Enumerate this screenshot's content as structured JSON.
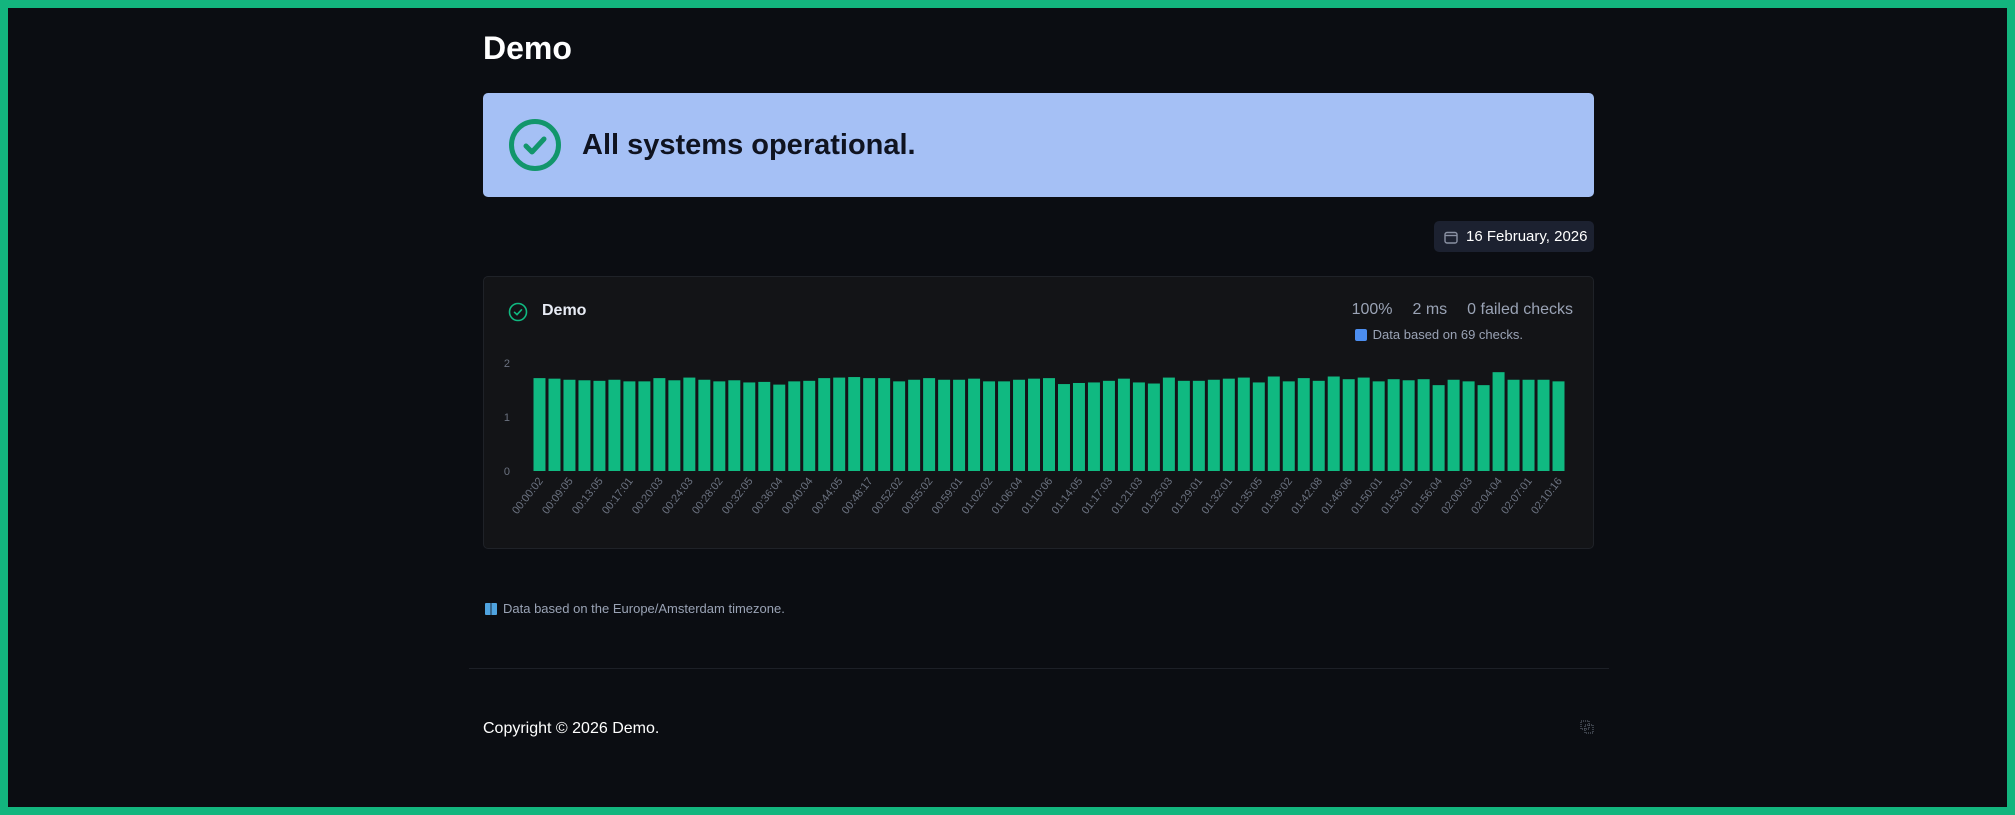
{
  "page": {
    "title": "Demo"
  },
  "banner": {
    "message": "All systems operational.",
    "icon": "check-circle-icon",
    "bg_color": "#a5c0f5",
    "icon_color": "#12966b"
  },
  "date_picker": {
    "value": "16 February, 2026",
    "icon": "calendar-icon"
  },
  "monitor": {
    "name": "Demo",
    "status_icon": "check-circle-icon",
    "uptime": "100%",
    "response_time": "2 ms",
    "failed_checks": "0 failed checks",
    "data_note": "Data based on 69 checks."
  },
  "chart_data": {
    "type": "bar",
    "color": "#10b981",
    "ylim": [
      0,
      2
    ],
    "yticks": [
      "0",
      "1",
      "2"
    ],
    "xlabel": "",
    "ylabel": "",
    "tick_labels": [
      "00:00:02",
      "00:09:05",
      "00:13:05",
      "00:17:01",
      "00:20:03",
      "00:24:03",
      "00:28:02",
      "00:32:05",
      "00:36:04",
      "00:40:04",
      "00:44:05",
      "00:48:17",
      "00:52:02",
      "00:55:02",
      "00:59:01",
      "01:02:02",
      "01:06:04",
      "01:10:06",
      "01:14:05",
      "01:17:03",
      "01:21:03",
      "01:25:03",
      "01:29:01",
      "01:32:01",
      "01:35:05",
      "01:39:02",
      "01:42:08",
      "01:46:06",
      "01:50:01",
      "01:53:01",
      "01:56:04",
      "02:00:03",
      "02:04:04",
      "02:07:01",
      "02:10:16"
    ],
    "values": [
      1.72,
      1.71,
      1.69,
      1.68,
      1.67,
      1.69,
      1.66,
      1.66,
      1.72,
      1.68,
      1.73,
      1.69,
      1.66,
      1.68,
      1.64,
      1.65,
      1.6,
      1.66,
      1.67,
      1.72,
      1.73,
      1.74,
      1.72,
      1.72,
      1.66,
      1.69,
      1.72,
      1.69,
      1.69,
      1.71,
      1.66,
      1.66,
      1.69,
      1.71,
      1.72,
      1.61,
      1.63,
      1.64,
      1.67,
      1.71,
      1.64,
      1.62,
      1.73,
      1.67,
      1.67,
      1.69,
      1.71,
      1.73,
      1.64,
      1.75,
      1.66,
      1.72,
      1.67,
      1.75,
      1.7,
      1.73,
      1.66,
      1.7,
      1.68,
      1.7,
      1.59,
      1.69,
      1.66,
      1.59,
      1.83,
      1.69,
      1.69,
      1.69,
      1.66
    ]
  },
  "footer": {
    "timezone_note": "Data based on the Europe/Amsterdam timezone.",
    "copyright": "Copyright © 2026 Demo.",
    "icon": "copy-icon"
  }
}
